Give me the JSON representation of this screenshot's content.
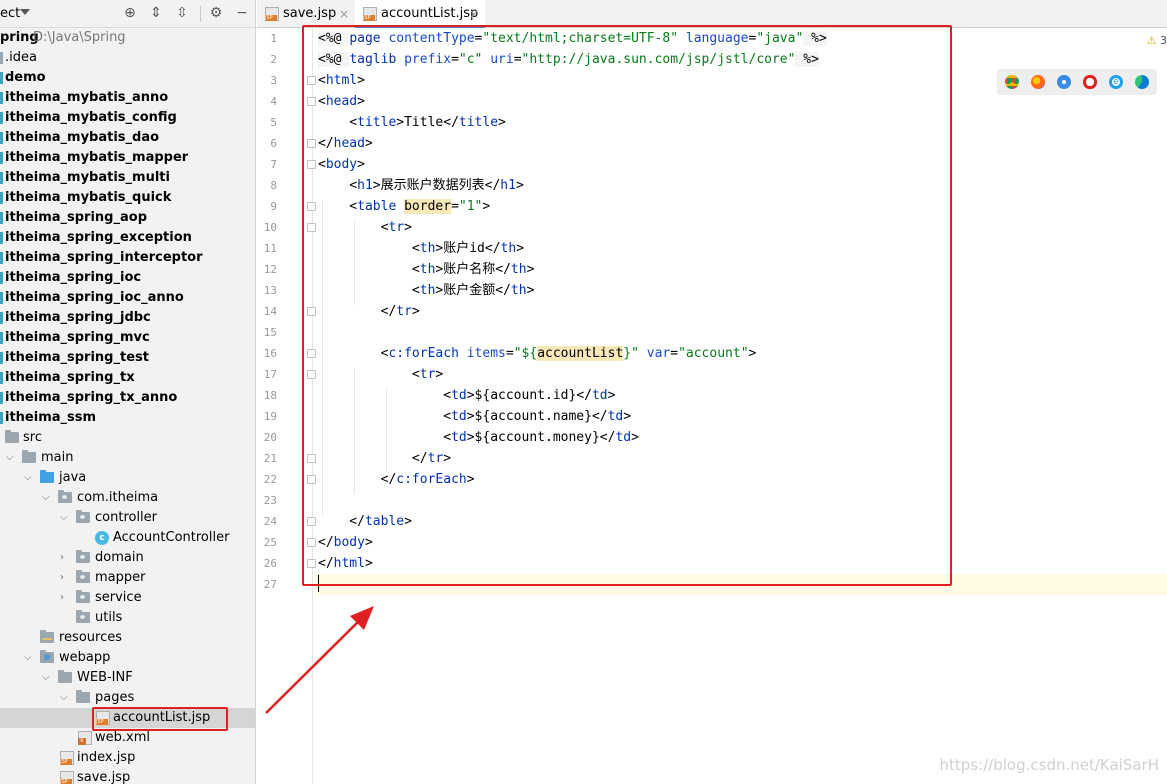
{
  "project_panel": {
    "title": "ect",
    "root": {
      "name": "pring",
      "path": "D:\\Java\\Spring"
    },
    "items": [
      {
        "label": ".idea",
        "bold": false
      },
      {
        "label": "demo",
        "bold": true
      },
      {
        "label": "itheima_mybatis_anno",
        "bold": true
      },
      {
        "label": "itheima_mybatis_config",
        "bold": true
      },
      {
        "label": "itheima_mybatis_dao",
        "bold": true
      },
      {
        "label": "itheima_mybatis_mapper",
        "bold": true
      },
      {
        "label": "itheima_mybatis_multi",
        "bold": true
      },
      {
        "label": "itheima_mybatis_quick",
        "bold": true
      },
      {
        "label": "itheima_spring_aop",
        "bold": true
      },
      {
        "label": "itheima_spring_exception",
        "bold": true
      },
      {
        "label": "itheima_spring_interceptor",
        "bold": true
      },
      {
        "label": "itheima_spring_ioc",
        "bold": true
      },
      {
        "label": "itheima_spring_ioc_anno",
        "bold": true
      },
      {
        "label": "itheima_spring_jdbc",
        "bold": true
      },
      {
        "label": "itheima_spring_mvc",
        "bold": true
      },
      {
        "label": "itheima_spring_test",
        "bold": true
      },
      {
        "label": "itheima_spring_tx",
        "bold": true
      },
      {
        "label": "itheima_spring_tx_anno",
        "bold": true
      },
      {
        "label": "itheima_ssm",
        "bold": true
      }
    ],
    "src": "src",
    "main": "main",
    "java": "java",
    "package": "com.itheima",
    "controller": "controller",
    "controller_class": "AccountController",
    "domain": "domain",
    "mapper": "mapper",
    "service": "service",
    "utils": "utils",
    "resources": "resources",
    "webapp": "webapp",
    "webinf": "WEB-INF",
    "pages": "pages",
    "account_list_file": "accountList.jsp",
    "web_xml": "web.xml",
    "index_jsp": "index.jsp",
    "save_jsp": "save.jsp"
  },
  "tabs": [
    {
      "label": "save.jsp",
      "active": false
    },
    {
      "label": "accountList.jsp",
      "active": true
    }
  ],
  "warnings": "3",
  "browser_icons": [
    "chrome-icon",
    "firefox-icon",
    "safari-icon",
    "opera-icon",
    "ie-icon",
    "edge-icon"
  ],
  "line_numbers": [
    "1",
    "2",
    "3",
    "4",
    "5",
    "6",
    "7",
    "8",
    "9",
    "10",
    "11",
    "12",
    "13",
    "14",
    "15",
    "16",
    "17",
    "18",
    "19",
    "20",
    "21",
    "22",
    "23",
    "24",
    "25",
    "26",
    "27"
  ],
  "code": {
    "l1": [
      "<%@ ",
      "page ",
      "contentType",
      "=",
      "\"text/html;charset=UTF-8\"",
      " ",
      "language",
      "=",
      "\"java\"",
      " %>"
    ],
    "l2": [
      "<%@ ",
      "taglib ",
      "prefix",
      "=",
      "\"c\"",
      " ",
      "uri",
      "=",
      "\"http://java.sun.com/jsp/jstl/core\"",
      " %>"
    ],
    "l3": [
      "<",
      "html",
      ">"
    ],
    "l4": [
      "<",
      "head",
      ">"
    ],
    "l5": [
      "    <",
      "title",
      ">",
      "Title",
      "</",
      "title",
      ">"
    ],
    "l6": [
      "</",
      "head",
      ">"
    ],
    "l7": [
      "<",
      "body",
      ">"
    ],
    "l8": [
      "    <",
      "h1",
      ">",
      "展示账户数据列表",
      "</",
      "h1",
      ">"
    ],
    "l9": [
      "    <",
      "table ",
      "border",
      "=",
      "\"1\"",
      ">"
    ],
    "l10": [
      "        <",
      "tr",
      ">"
    ],
    "l11": [
      "            <",
      "th",
      ">",
      "账户id",
      "</",
      "th",
      ">"
    ],
    "l12": [
      "            <",
      "th",
      ">",
      "账户名称",
      "</",
      "th",
      ">"
    ],
    "l13": [
      "            <",
      "th",
      ">",
      "账户金额",
      "</",
      "th",
      ">"
    ],
    "l14": [
      "        </",
      "tr",
      ">"
    ],
    "l16": [
      "        <",
      "c:forEach ",
      "items",
      "=",
      "\"${",
      "accountList",
      "}\"",
      " ",
      "var",
      "=",
      "\"account\"",
      ">"
    ],
    "l17": [
      "            <",
      "tr",
      ">"
    ],
    "l18": [
      "                <",
      "td",
      ">",
      "${",
      "account.id",
      "}",
      "</",
      "td",
      ">"
    ],
    "l19": [
      "                <",
      "td",
      ">",
      "${",
      "account.name",
      "}",
      "</",
      "td",
      ">"
    ],
    "l20": [
      "                <",
      "td",
      ">",
      "${",
      "account.money",
      "}",
      "</",
      "td",
      ">"
    ],
    "l21": [
      "            </",
      "tr",
      ">"
    ],
    "l22": [
      "        </",
      "c:forEach",
      ">"
    ],
    "l24": [
      "    </",
      "table",
      ">"
    ],
    "l25": [
      "</",
      "body",
      ">"
    ],
    "l26": [
      "</",
      "html",
      ">"
    ]
  },
  "watermark": "https://blog.csdn.net/KaiSarH",
  "colors": {
    "highlight_box": "#e02020",
    "tag": "#0033b3",
    "attr": "#174ad4",
    "string": "#067d17",
    "current_line": "#fffae3"
  }
}
